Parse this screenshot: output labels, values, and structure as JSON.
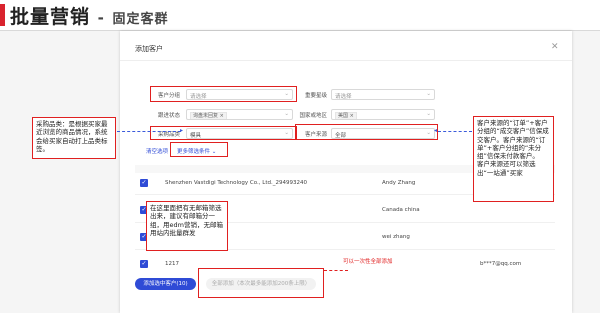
{
  "header": {
    "title_main": "批量营销",
    "title_sep": "-",
    "title_sub": "固定客群"
  },
  "modal": {
    "title": "添加客户",
    "close_icon": "close-icon"
  },
  "filters": {
    "customer_group_label": "客户分组",
    "customer_group_placeholder": "请选择",
    "importance_label": "重要星级",
    "importance_placeholder": "请选择",
    "follow_status_label": "跟进状态",
    "follow_status_tag": "询盘未回复",
    "region_label": "国家或地区",
    "region_tag": "美国",
    "product_label": "采购品类",
    "product_value": "模具",
    "source_label": "客户来源",
    "source_value": "全部",
    "clear_filters": "清空选项",
    "more_filters": "更多筛选条件"
  },
  "table": {
    "rows": [
      {
        "company": "Shenzhen Vastdigi Technology Co., Ltd._294993240",
        "contact": "Andy Zhang",
        "email": ""
      },
      {
        "company": "",
        "contact": "Canada china",
        "email": ""
      },
      {
        "company": "",
        "contact": "wei zhang",
        "email": ""
      },
      {
        "company": "1217",
        "contact": "",
        "email": "b***7@qq.com"
      }
    ]
  },
  "notes": {
    "left": "采购品类：是根据买家最近浏览的商品情况，系统会给买家自动打上品类标签。",
    "right": "客户来源的“订单”+客户分组的“成交客户”信保成交客户。客户来源的“订单”+客户分组的“未分组”信保未付款客户。\n客户来源还可以筛选出“一站通”买家",
    "middle": "在这里面把有无邮箱筛选出来，建议有邮箱分一组，用edm营销，无邮箱用站内批量群发",
    "red_hint": "可以一次性全部添加"
  },
  "buttons": {
    "add_selected": "添加选中客户(10)",
    "add_all": "全部添加（本次最多能添加200条上限）"
  },
  "colors": {
    "accent_red": "#e02020",
    "primary_blue": "#2f4bd6",
    "brand_bar": "#d9232e"
  }
}
